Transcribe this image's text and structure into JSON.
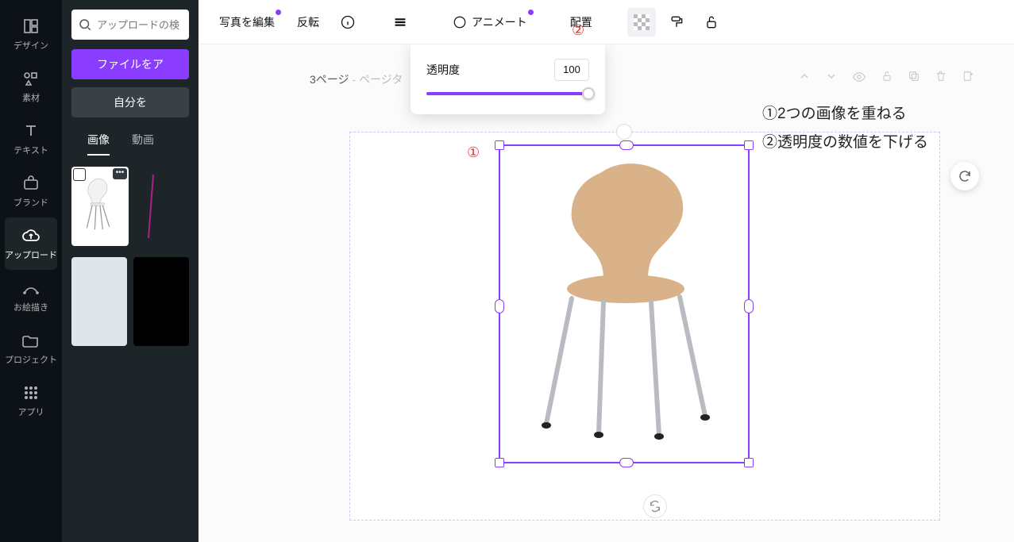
{
  "nav": [
    {
      "id": "design",
      "label": "デザイン"
    },
    {
      "id": "elements",
      "label": "素材"
    },
    {
      "id": "text",
      "label": "テキスト"
    },
    {
      "id": "brand",
      "label": "ブランド"
    },
    {
      "id": "uploads",
      "label": "アップロード"
    },
    {
      "id": "draw",
      "label": "お絵描き"
    },
    {
      "id": "projects",
      "label": "プロジェクト"
    },
    {
      "id": "apps",
      "label": "アプリ"
    }
  ],
  "uploads_panel": {
    "search_placeholder": "アップロードの検",
    "upload_btn": "ファイルをア",
    "self_record_btn": "自分を",
    "tabs": {
      "images": "画像",
      "videos": "動画"
    }
  },
  "toolbar": {
    "edit_photo": "写真を編集",
    "flip": "反転",
    "animate": "アニメート",
    "position": "配置"
  },
  "page_header": {
    "page_text": "3ページ",
    "sep": " - ",
    "page_sub": "ページタ"
  },
  "popover": {
    "label": "透明度",
    "value": "100"
  },
  "annotations": {
    "marker1": "①",
    "marker2": "②",
    "text1": "①2つの画像を重ねる",
    "text2": "②透明度の数値を下げる"
  },
  "colors": {
    "brand_purple": "#8b3dff",
    "anno_red": "#e53935"
  }
}
